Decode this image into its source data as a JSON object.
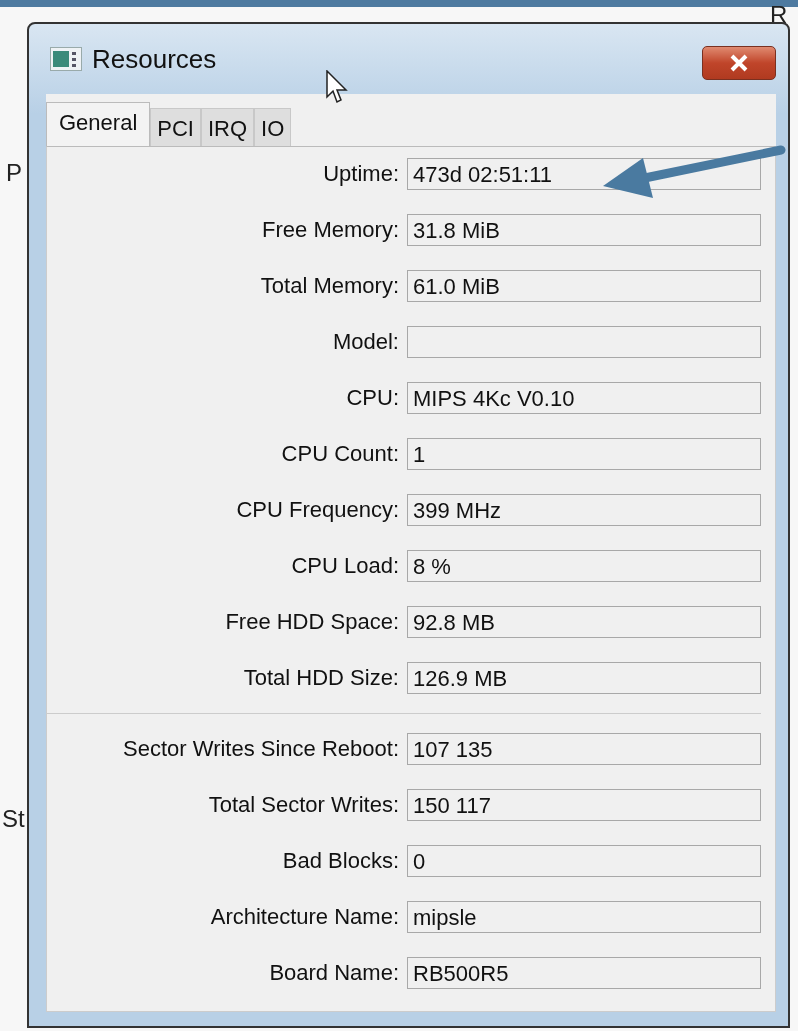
{
  "background": {
    "texts": [
      "P",
      "St",
      "R"
    ]
  },
  "window": {
    "title": "Resources"
  },
  "tabs": [
    {
      "label": "General",
      "selected": true
    },
    {
      "label": "PCI",
      "selected": false
    },
    {
      "label": "IRQ",
      "selected": false
    },
    {
      "label": "IO",
      "selected": false
    }
  ],
  "groups": [
    {
      "fields": [
        {
          "label": "Uptime:",
          "value": "473d 02:51:11"
        },
        {
          "label": "Free Memory:",
          "value": "31.8 MiB"
        },
        {
          "label": "Total Memory:",
          "value": "61.0 MiB"
        },
        {
          "label": "Model:"
        },
        {
          "label": "CPU:",
          "value": "MIPS 4Kc V0.10"
        },
        {
          "label": "CPU Count:",
          "value": "1"
        },
        {
          "label": "CPU Frequency:",
          "value": "399 MHz"
        },
        {
          "label": "CPU Load:",
          "value": "8 %"
        },
        {
          "label": "Free HDD Space:",
          "value": "92.8 MB"
        },
        {
          "label": "Total HDD Size:",
          "value": "126.9 MB"
        }
      ]
    },
    {
      "fields": [
        {
          "label": "Sector Writes Since Reboot:",
          "value": "107 135"
        },
        {
          "label": "Total Sector Writes:",
          "value": "150 117"
        },
        {
          "label": "Bad Blocks:",
          "value": "0"
        },
        {
          "label": "Architecture Name:",
          "value": "mipsle"
        },
        {
          "label": "Board Name:",
          "value": "RB500R5"
        }
      ]
    }
  ]
}
